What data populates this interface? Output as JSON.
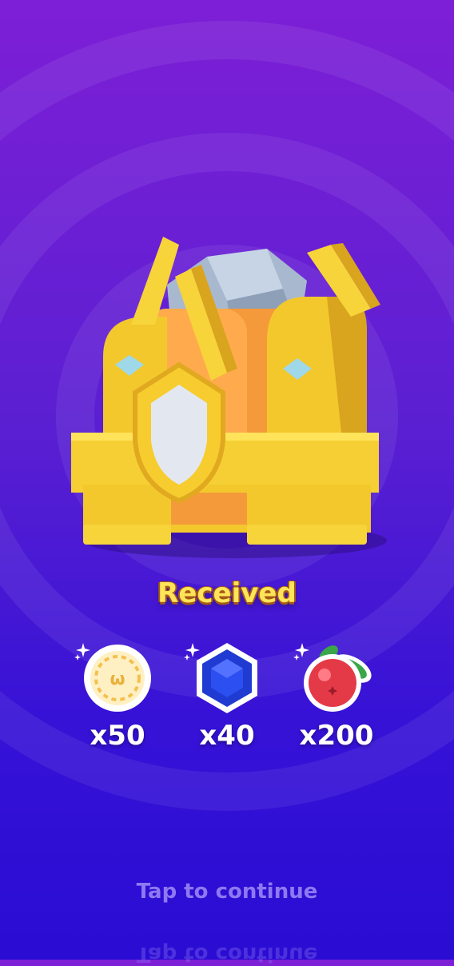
{
  "screen": {
    "title": "Received",
    "continue_label": "Tap to continue"
  },
  "rewards": [
    {
      "icon": "coin-icon",
      "count": "x50"
    },
    {
      "icon": "sapphire-gem-icon",
      "count": "x40"
    },
    {
      "icon": "cranberry-icon",
      "count": "x200"
    }
  ],
  "colors": {
    "background_top": "#7d1fd6",
    "background_bottom": "#2a0cd3",
    "title": "#ffe45a",
    "continue_text": "#8f79f2"
  }
}
